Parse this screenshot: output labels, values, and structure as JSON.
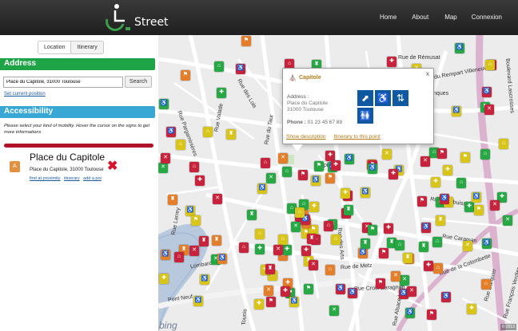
{
  "header": {
    "logo_text": "Street",
    "nav": [
      "Home",
      "About",
      "Map",
      "Connexion"
    ]
  },
  "sidebar": {
    "tabs": [
      "Location",
      "Itinerary"
    ],
    "address_heading": "Address",
    "search_value": "Place du Capitole, 31000 Toulouse",
    "search_button": "Search",
    "set_position": "Set current position",
    "accessibility_heading": "Accessibility",
    "mobility_note": "Please select your kind of mobility. Hover the cursor on the signs to get more informations",
    "place_icon_letter": "A",
    "place_title": "Place du Capitole",
    "place_address": "Place du Capitole, 31000 Toulouse",
    "place_links": [
      "find at proximity",
      "itinerary",
      "add a poi"
    ]
  },
  "map": {
    "road_labels": [
      {
        "text": "Rue des Salenques"
      },
      {
        "text": "Rue Valade"
      },
      {
        "text": "Rue du Taur"
      },
      {
        "text": "Rue des Lois"
      },
      {
        "text": "Rue Pargaminières"
      },
      {
        "text": "Rue d'Aubuisson"
      },
      {
        "text": "Rue de Metz"
      },
      {
        "text": "Pont Neuf"
      },
      {
        "text": "Rue Larrey"
      },
      {
        "text": "Rue Caraman"
      },
      {
        "text": "Rue des Arts"
      },
      {
        "text": "Rue de Rémusat"
      },
      {
        "text": "Capitole"
      },
      {
        "text": "Boulevard Lascrosses"
      },
      {
        "text": "Rue Darquier"
      },
      {
        "text": "Rue François Verdier"
      },
      {
        "text": "Rue Alsace Lorraine"
      },
      {
        "text": "Lombard"
      },
      {
        "text": "Tounis"
      },
      {
        "text": "Rue du Rempart Villeneuve"
      },
      {
        "text": "Rue de la Colombette"
      },
      {
        "text": "Rue Croix Baragnon"
      }
    ],
    "copyright": "© 2013",
    "provider": "bing"
  },
  "popup": {
    "title": "Capitole",
    "address_label": "Address :",
    "address_lines": [
      "Place du Capitole",
      "31000 Toulouse"
    ],
    "phone_label": "Phone :",
    "phone": "01 23 45 67 89",
    "links": [
      "Show description",
      "Itinerary to this point"
    ],
    "close": "x"
  },
  "colors": {
    "topbar": "#262626",
    "address_green": "#1ea446",
    "access_blue": "#38a7d4",
    "slider_red": "#b0122a",
    "link_blue": "#1a5aa0",
    "popup_link": "#b27a14",
    "marker_red": "#c8233c",
    "marker_green": "#28a745",
    "marker_orange": "#e37f2a",
    "marker_yellow": "#d9c51a"
  }
}
